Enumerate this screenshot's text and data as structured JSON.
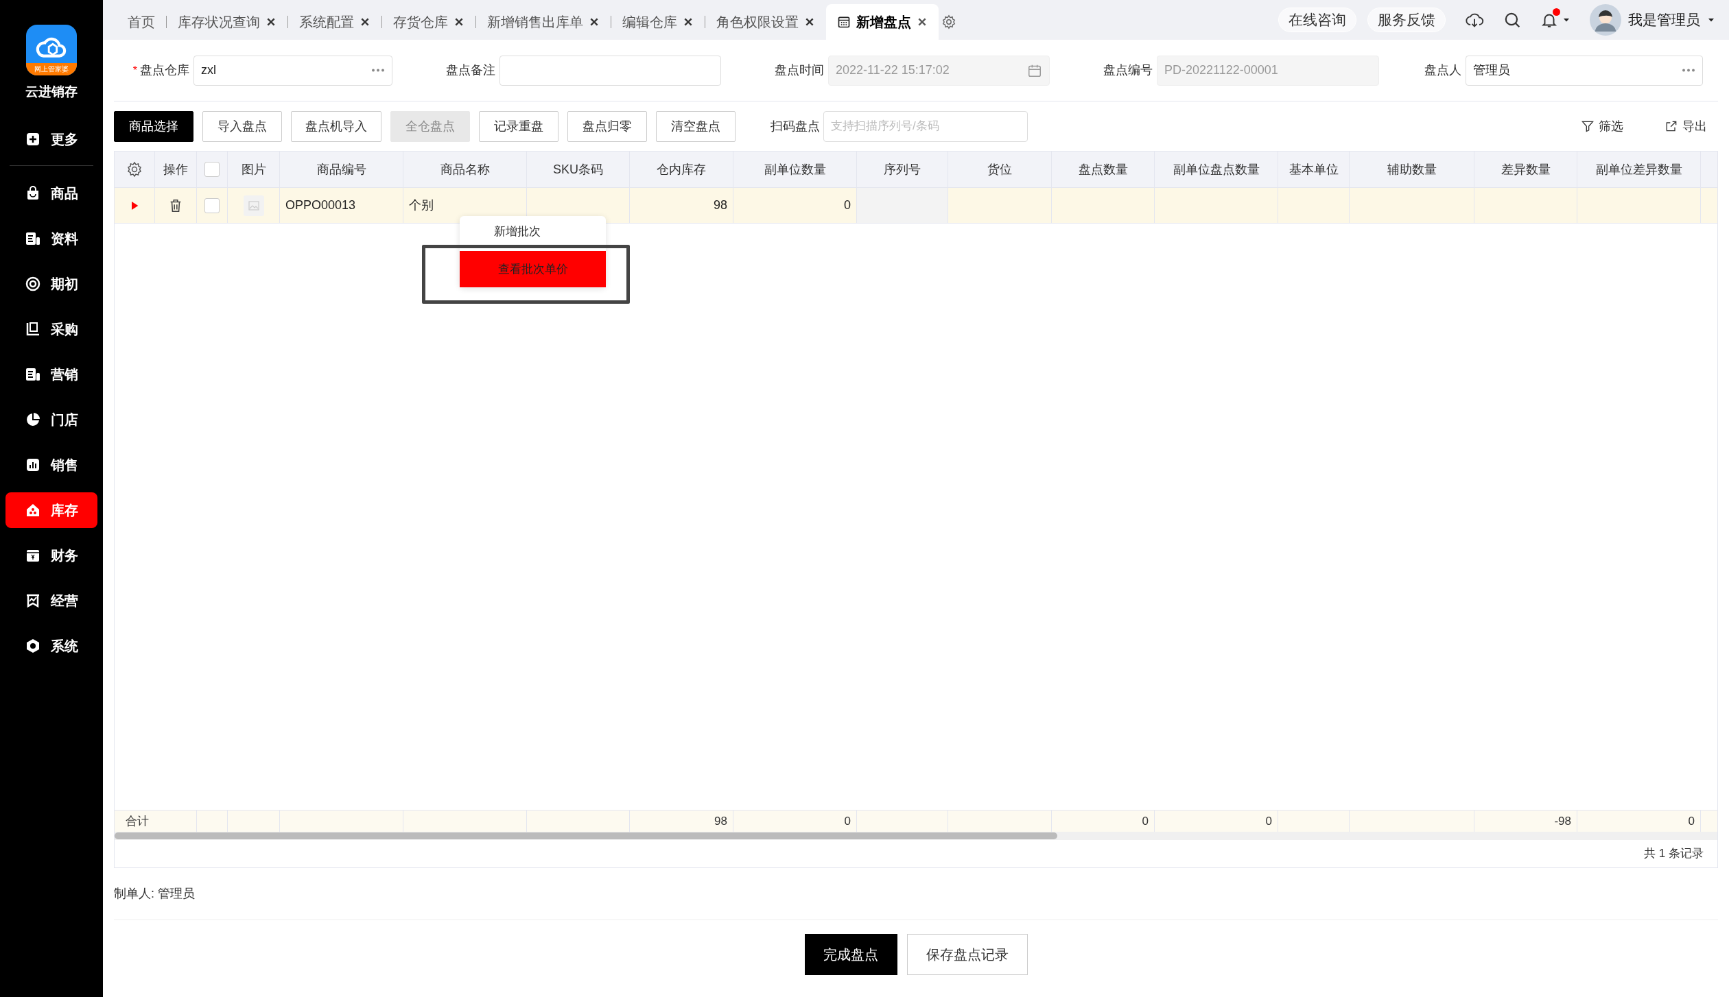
{
  "logo": {
    "badge": "网上管家婆",
    "name": "云进销存"
  },
  "sidebar": {
    "items": [
      {
        "label": "更多",
        "selected": false
      },
      {
        "label": "商品",
        "selected": false
      },
      {
        "label": "资料",
        "selected": false
      },
      {
        "label": "期初",
        "selected": false
      },
      {
        "label": "采购",
        "selected": false
      },
      {
        "label": "营销",
        "selected": false
      },
      {
        "label": "门店",
        "selected": false
      },
      {
        "label": "销售",
        "selected": false
      },
      {
        "label": "库存",
        "selected": true
      },
      {
        "label": "财务",
        "selected": false
      },
      {
        "label": "经营",
        "selected": false
      },
      {
        "label": "系统",
        "selected": false
      }
    ]
  },
  "tabs": [
    {
      "label": "首页",
      "selected": false,
      "closable": false
    },
    {
      "label": "库存状况查询",
      "selected": false,
      "closable": true
    },
    {
      "label": "系统配置",
      "selected": false,
      "closable": true
    },
    {
      "label": "存货仓库",
      "selected": false,
      "closable": true
    },
    {
      "label": "新增销售出库单",
      "selected": false,
      "closable": true
    },
    {
      "label": "编辑仓库",
      "selected": false,
      "closable": true
    },
    {
      "label": "角色权限设置",
      "selected": false,
      "closable": true
    },
    {
      "label": "新增盘点",
      "selected": true,
      "closable": true
    }
  ],
  "top_links": [
    "在线咨询",
    "服务反馈"
  ],
  "notifications": {
    "unread": true
  },
  "user": {
    "name": "我是管理员"
  },
  "form": {
    "fields": [
      {
        "label": "盘点仓库",
        "value": "zxl",
        "required_mark": "*",
        "kind": "picker",
        "disabled": false
      },
      {
        "label": "盘点备注",
        "kind": "text",
        "disabled": false
      },
      {
        "label": "盘点时间",
        "value": "2022-11-22 15:17:02",
        "kind": "date",
        "disabled": true
      },
      {
        "label": "盘点编号",
        "value": "PD-20221122-00001",
        "kind": "text",
        "disabled": true
      },
      {
        "label": "盘点人",
        "value": "管理员",
        "kind": "picker",
        "disabled": false
      }
    ]
  },
  "toolbar": {
    "buttons": [
      {
        "label": "商品选择",
        "primary": true,
        "disabled": false
      },
      {
        "label": "导入盘点",
        "primary": false,
        "disabled": false
      },
      {
        "label": "盘点机导入",
        "primary": false,
        "disabled": false
      },
      {
        "label": "全仓盘点",
        "primary": false,
        "disabled": true
      },
      {
        "label": "记录重盘",
        "primary": false,
        "disabled": false
      },
      {
        "label": "盘点归零",
        "primary": false,
        "disabled": false
      },
      {
        "label": "清空盘点",
        "primary": false,
        "disabled": false
      }
    ],
    "scan": {
      "label": "扫码盘点",
      "placeholder": "支持扫描序列号/条码"
    },
    "actions": [
      "筛选",
      "导出"
    ]
  },
  "table": {
    "columns": [
      "操作",
      "图片",
      "商品编号",
      "商品名称",
      "SKU条码",
      "仓内库存",
      "副单位数量",
      "序列号",
      "货位",
      "盘点数量",
      "副单位盘点数量",
      "基本单位",
      "辅助数量",
      "差异数量",
      "副单位差异数量"
    ],
    "all_checked": false,
    "rows": [
      {
        "checked": false,
        "expanded": false,
        "cells": [
          {},
          {},
          {
            "text": "OPPO00013"
          },
          {
            "text": "个别"
          },
          {},
          {
            "text": "98"
          },
          {
            "text": "0"
          },
          {
            "disabled": true
          },
          {},
          {},
          {},
          {},
          {},
          {},
          {}
        ]
      }
    ],
    "totals": {
      "cells": [
        {
          "text": "合计"
        },
        {},
        {},
        {},
        {},
        {
          "text": "98"
        },
        {
          "text": "0"
        },
        {},
        {},
        {
          "text": "0"
        },
        {
          "text": "0"
        },
        {},
        {},
        {
          "text": "-98"
        },
        {
          "text": "0"
        }
      ]
    },
    "record_count": "共 1 条记录"
  },
  "context_menu": {
    "items": [
      {
        "label": "新增批次",
        "selected": false
      },
      {
        "label": "查看批次单价",
        "selected": true
      }
    ]
  },
  "creator": "制单人: 管理员",
  "footer_buttons": [
    {
      "label": "完成盘点",
      "primary": true
    },
    {
      "label": "保存盘点记录",
      "primary": false
    }
  ]
}
